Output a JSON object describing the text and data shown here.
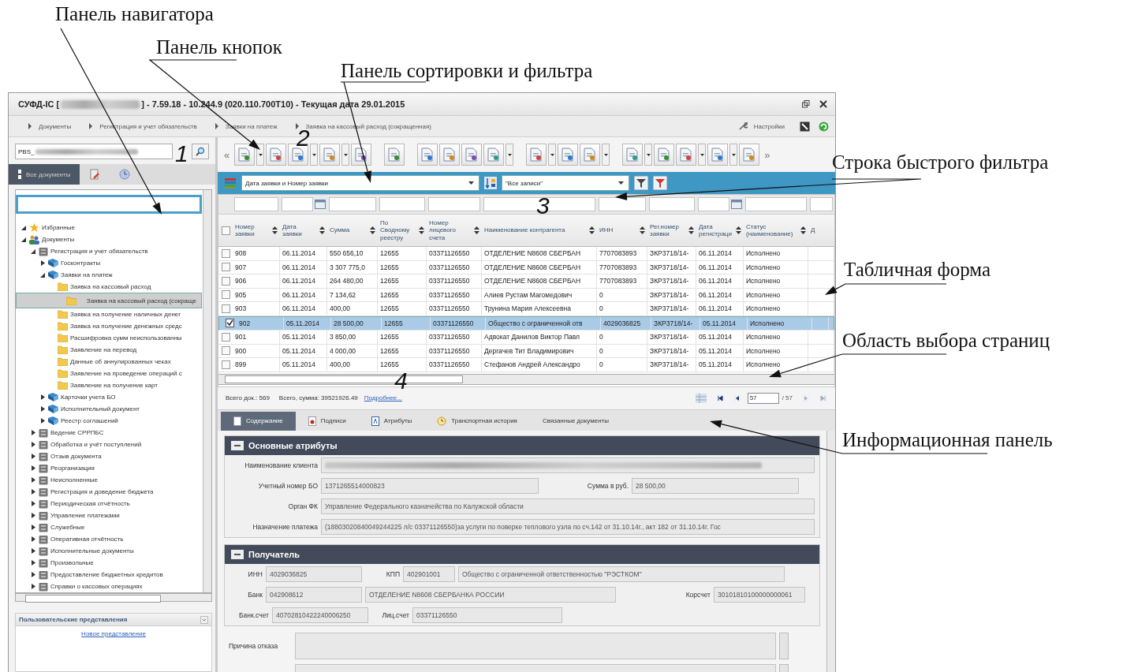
{
  "callouts": [
    {
      "text": "Панель навигатора"
    },
    {
      "text": "Панель кнопок"
    },
    {
      "text": "Панель сортировки и фильтра"
    },
    {
      "text": "Строка быстрого фильтра"
    },
    {
      "text": "Табличная форма"
    },
    {
      "text": "Область выбора страниц"
    },
    {
      "text": "Информационная панель"
    }
  ],
  "markers": [
    {
      "text": "1"
    },
    {
      "text": "2"
    },
    {
      "text": "3"
    },
    {
      "text": "4"
    }
  ],
  "window": {
    "title_prefix": "СУФД-IC [",
    "title_redacted": true,
    "title_suffix": "] - 7.59.18 - 10.244.9 (020.110.700T10) - Текущая дата 29.01.2015"
  },
  "breadcrumb": [
    "Документы",
    "Регистрация и учет обязательств",
    "Заявки на платеж",
    "Заявка на кассовый расход (сокращенная)"
  ],
  "settings_link": "Настройки",
  "navigator": {
    "search_value": "РВS_",
    "search_redacted": true,
    "tabs": [
      {
        "kind": "text",
        "label": "Все документы",
        "selected": true
      },
      {
        "kind": "document",
        "selected": false
      },
      {
        "kind": "clock",
        "selected": false
      }
    ],
    "tree": [
      {
        "label": "Избранные",
        "kind": "star",
        "expanded": true,
        "selected": false
      },
      {
        "label": "Документы",
        "kind": "users",
        "expanded": true,
        "selected": false,
        "children": [
          {
            "label": "Регистрация и учет обязательств",
            "kind": "cabinet",
            "expanded": true,
            "selected": false,
            "children": [
              {
                "label": "Госконтракты",
                "kind": "book",
                "expanded": false,
                "selected": false
              },
              {
                "label": "Заявки на платеж",
                "kind": "book",
                "expanded": true,
                "selected": false,
                "children": [
                  {
                    "label": "Заявка на кассовый расход",
                    "kind": "folder",
                    "selected": false
                  },
                  {
                    "label": "Заявка на кассовый расход (сокраще",
                    "kind": "folder",
                    "selected": true
                  },
                  {
                    "label": "Заявка на получение наличных денег",
                    "kind": "folder",
                    "selected": false
                  },
                  {
                    "label": "Заявка на получение денежных средс",
                    "kind": "folder",
                    "selected": false
                  },
                  {
                    "label": "Расшифровка сумм неиспользованны",
                    "kind": "folder",
                    "selected": false
                  },
                  {
                    "label": "Заявление на перевод",
                    "kind": "folder",
                    "selected": false
                  },
                  {
                    "label": "Данные об аннулированных чеках",
                    "kind": "folder",
                    "selected": false
                  },
                  {
                    "label": "Заявление на проведение операций с",
                    "kind": "folder",
                    "selected": false
                  },
                  {
                    "label": "Заявление на получение карт",
                    "kind": "folder",
                    "selected": false
                  }
                ]
              },
              {
                "label": "Карточки учета БО",
                "kind": "book",
                "expanded": false,
                "selected": false
              },
              {
                "label": "Исполнительный документ",
                "kind": "book",
                "expanded": false,
                "selected": false
              },
              {
                "label": "Реестр соглашений",
                "kind": "book",
                "expanded": false,
                "selected": false
              }
            ]
          },
          {
            "label": "Ведение СРРПБС",
            "kind": "cabinet",
            "expanded": false,
            "selected": false
          },
          {
            "label": "Обработка и учёт поступлений",
            "kind": "cabinet",
            "expanded": false,
            "selected": false
          },
          {
            "label": "Отзыв документа",
            "kind": "cabinet",
            "expanded": false,
            "selected": false
          },
          {
            "label": "Реорганизация",
            "kind": "cabinet",
            "expanded": false,
            "selected": false
          },
          {
            "label": "Неисполненные",
            "kind": "cabinet",
            "expanded": false,
            "selected": false
          },
          {
            "label": "Регистрация и доведение бюджета",
            "kind": "cabinet",
            "expanded": false,
            "selected": false
          },
          {
            "label": "Периодическая отчётность",
            "kind": "cabinet",
            "expanded": false,
            "selected": false
          },
          {
            "label": "Управление платежами",
            "kind": "cabinet",
            "expanded": false,
            "selected": false
          },
          {
            "label": "Служебные",
            "kind": "cabinet",
            "expanded": false,
            "selected": false
          },
          {
            "label": "Оперативная отчётность",
            "kind": "cabinet",
            "expanded": false,
            "selected": false
          },
          {
            "label": "Исполнительные документы",
            "kind": "cabinet",
            "expanded": false,
            "selected": false
          },
          {
            "label": "Произвольные",
            "kind": "cabinet",
            "expanded": false,
            "selected": false
          },
          {
            "label": "Предоставление бюджетных кредитов",
            "kind": "cabinet",
            "expanded": false,
            "selected": false
          },
          {
            "label": "Справки о кассовых операциях",
            "kind": "cabinet",
            "expanded": false,
            "selected": false
          }
        ]
      }
    ],
    "views_header": "Пользовательские представления",
    "new_view_link": "Новое представление"
  },
  "toolbar": {
    "scroll_left": "«",
    "scroll_right": "»"
  },
  "sort_bar": {
    "sort_value": "Дата заявки и Номер заявки",
    "filter_value": "\"Все записи\""
  },
  "table": {
    "select_all_checked": false,
    "columns": [
      {
        "label": "Номер\nзаявки",
        "kind": "text"
      },
      {
        "label": "Дата\nзаявки",
        "kind": "date"
      },
      {
        "label": "Сумма",
        "kind": "text"
      },
      {
        "label": "По\nСводному\nреестру",
        "kind": "text"
      },
      {
        "label": "Номер\nлицевого\nсчета",
        "kind": "text"
      },
      {
        "label": "Наименование контрагента",
        "kind": "text"
      },
      {
        "label": "ИНН",
        "kind": "text"
      },
      {
        "label": "Рег.номер\nзаявки",
        "kind": "text"
      },
      {
        "label": "Дата\nрегистраци",
        "kind": "date"
      },
      {
        "label": "Статус\n(наименование)",
        "kind": "text"
      },
      {
        "label": "Д",
        "kind": "text"
      }
    ],
    "rows": [
      {
        "checked": false,
        "selected": false,
        "cells": [
          "908",
          "06.11.2014",
          "550 656,10",
          "12655",
          "03371126550",
          "ОТДЕЛЕНИЕ N8608 СБЕРБАН",
          "7707083893",
          "ЗКР3718/14-",
          "06.11.2014",
          "Исполнено"
        ]
      },
      {
        "checked": false,
        "selected": false,
        "cells": [
          "907",
          "06.11.2014",
          "3 307 775,0",
          "12655",
          "03371126550",
          "ОТДЕЛЕНИЕ N8608 СБЕРБАН",
          "7707083893",
          "ЗКР3718/14-",
          "06.11.2014",
          "Исполнено"
        ]
      },
      {
        "checked": false,
        "selected": false,
        "cells": [
          "906",
          "06.11.2014",
          "264 480,00",
          "12655",
          "03371126550",
          "ОТДЕЛЕНИЕ N8608 СБЕРБАН",
          "7707083893",
          "ЗКР3718/14-",
          "06.11.2014",
          "Исполнено"
        ]
      },
      {
        "checked": false,
        "selected": false,
        "cells": [
          "905",
          "06.11.2014",
          "7 134,62",
          "12655",
          "03371126550",
          "Алиев Рустам Магомедович",
          "0",
          "ЗКР3718/14-",
          "06.11.2014",
          "Исполнено"
        ]
      },
      {
        "checked": false,
        "selected": false,
        "cells": [
          "903",
          "06.11.2014",
          "400,00",
          "12655",
          "03371126550",
          "Трунина Мария Алексеевна",
          "0",
          "ЗКР3718/14-",
          "06.11.2014",
          "Исполнено"
        ]
      },
      {
        "checked": true,
        "selected": true,
        "cells": [
          "902",
          "05.11.2014",
          "28 500,00",
          "12655",
          "03371126550",
          "Общество с ограниченной отв",
          "4029036825",
          "ЗКР3718/14-",
          "05.11.2014",
          "Исполнено"
        ]
      },
      {
        "checked": false,
        "selected": false,
        "cells": [
          "901",
          "05.11.2014",
          "3 850,00",
          "12655",
          "03371126550",
          "Адвокат Данилов Виктор Павл",
          "0",
          "ЗКР3718/14-",
          "05.11.2014",
          "Исполнено"
        ]
      },
      {
        "checked": false,
        "selected": false,
        "cells": [
          "900",
          "05.11.2014",
          "4 000,00",
          "12655",
          "03371126550",
          "Дергачев Тит Владимирович",
          "0",
          "ЗКР3718/14-",
          "05.11.2014",
          "Исполнено"
        ]
      },
      {
        "checked": false,
        "selected": false,
        "cells": [
          "899",
          "05.11.2014",
          "400,00",
          "12655",
          "03371126550",
          "Стефанов Андрей Александро",
          "0",
          "ЗКР3718/14-",
          "05.11.2014",
          "Исполнено"
        ]
      }
    ]
  },
  "footer": {
    "total_docs": "Всего док.: 569",
    "total_sum": "Всего, сумма: 39521926.49",
    "more_link": "Подробнее...",
    "page": "57",
    "page_count": "/ 57"
  },
  "info_tabs": [
    {
      "label": "Содержание",
      "kind": "content",
      "selected": true
    },
    {
      "label": "Подписи",
      "kind": "signature",
      "selected": false
    },
    {
      "label": "Атрибуты",
      "kind": "attributes",
      "selected": false
    },
    {
      "label": "Транспортная история",
      "kind": "history",
      "selected": false
    },
    {
      "label": "Связанные документы",
      "kind": "plain",
      "selected": false
    }
  ],
  "sections": [
    {
      "title": "Основные атрибуты",
      "rows": [
        [
          {
            "label": "Наименование клиента",
            "kind": "blurred"
          }
        ],
        [
          {
            "label": "Учетный номер БО",
            "value": "1371265514000823"
          },
          {
            "label": "Сумма в руб.",
            "value": "28 500,00"
          }
        ],
        [
          {
            "label": "Орган ФК",
            "value": "Управление Федерального казначейства по Калужской области"
          }
        ],
        [
          {
            "label": "Назначение платежа",
            "value": "(18803020840049244225 л/с 03371126550)за услуги по поверке теплового узла по сч.142 от 31.10.14г., акт 182 от 31.10.14г. Гос"
          }
        ]
      ]
    },
    {
      "title": "Получатель",
      "rows": [
        [
          {
            "label": "ИНН",
            "value": "4029036825"
          },
          {
            "label": "КПП",
            "value": "402901001"
          },
          {
            "value": "Общество с ограниченной ответственностью \"РЭСТКОМ\""
          }
        ],
        [
          {
            "label": "Банк",
            "value": "042908612"
          },
          {
            "value": "ОТДЕЛЕНИЕ N8608 СБЕРБАНКА РОССИИ"
          },
          {
            "label": "Корсчет",
            "value": "30101810100000000061"
          }
        ],
        [
          {
            "label": "Банк.счет",
            "value": "40702810422240006250"
          },
          {
            "label": "Лиц.счет",
            "value": "03371126550"
          }
        ]
      ]
    }
  ],
  "memo": {
    "label": "Причина отказа"
  }
}
